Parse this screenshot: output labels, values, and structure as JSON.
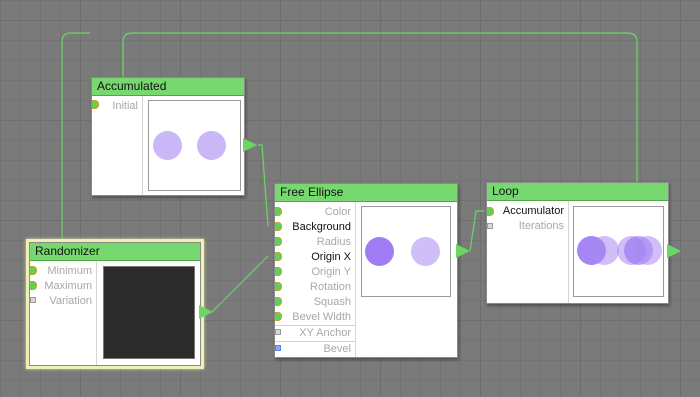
{
  "colors": {
    "wire": "#6cd664",
    "header": "#78d870",
    "circle_fill": "#a788f0",
    "circle_dark": "#8a5cf0"
  },
  "nodes": {
    "accumulated": {
      "title": "Accumulated",
      "ports": [
        "Initial"
      ]
    },
    "randomizer": {
      "title": "Randomizer",
      "ports": [
        "Minimum",
        "Maximum",
        "Variation"
      ]
    },
    "free_ellipse": {
      "title": "Free Ellipse",
      "ports": [
        "Color",
        "Background",
        "Radius",
        "Origin X",
        "Origin Y",
        "Rotation",
        "Squash",
        "Bevel Width",
        "XY Anchor",
        "Bevel"
      ]
    },
    "loop": {
      "title": "Loop",
      "ports": [
        "Accumulator",
        "Iterations"
      ]
    }
  }
}
